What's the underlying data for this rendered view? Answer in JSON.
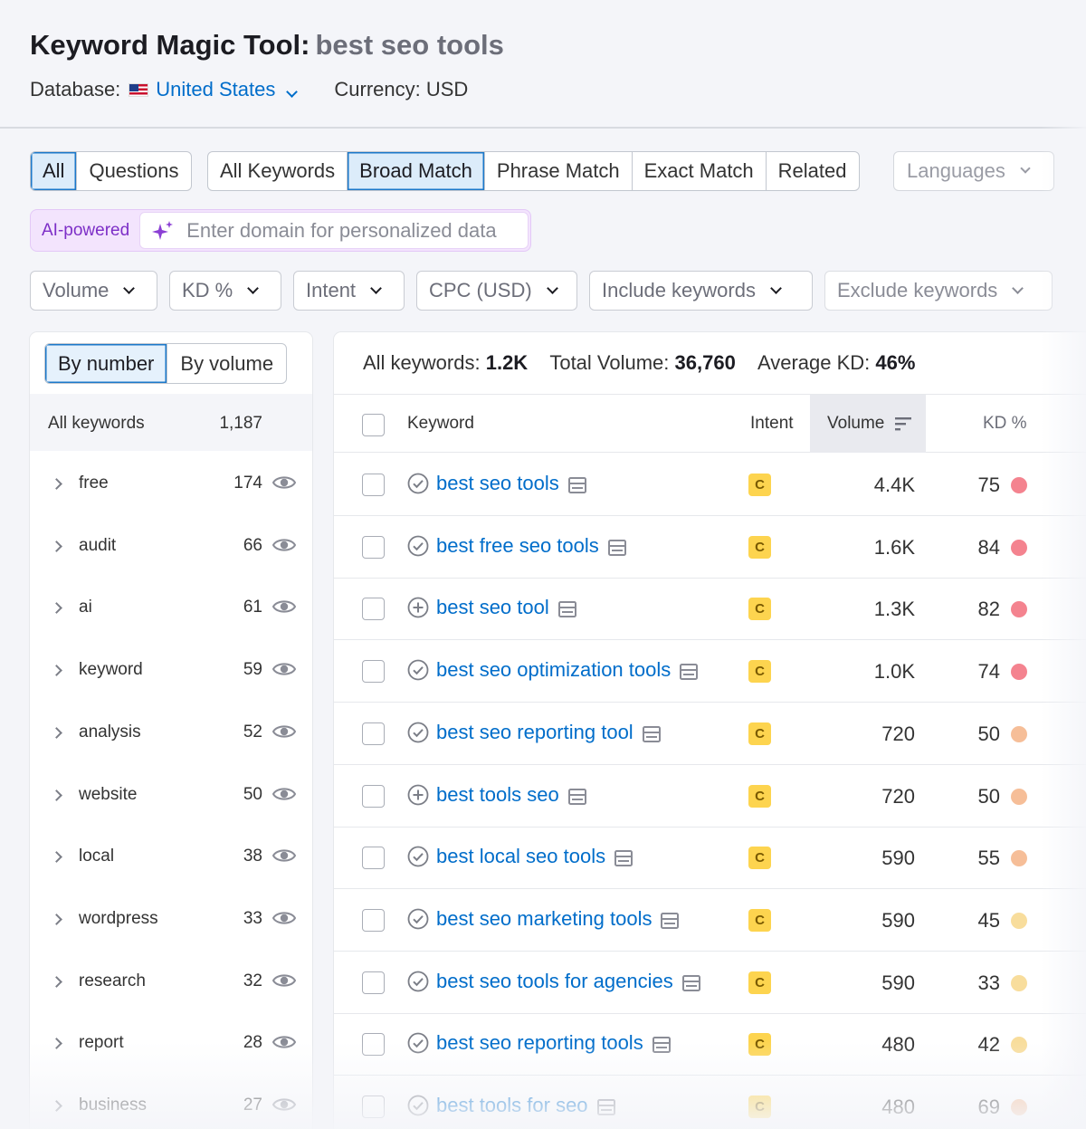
{
  "header": {
    "title": "Keyword Magic Tool:",
    "query": "best seo tools",
    "database_label": "Database:",
    "database_value": "United States",
    "currency": "Currency: USD"
  },
  "tabs": {
    "question_group": [
      "All",
      "Questions"
    ],
    "match_group": [
      "All Keywords",
      "Broad Match",
      "Phrase Match",
      "Exact Match",
      "Related"
    ],
    "active_question": "All",
    "active_match": "Broad Match",
    "languages": "Languages"
  },
  "ai": {
    "label": "AI-powered",
    "placeholder": "Enter domain for personalized data"
  },
  "filters": [
    "Volume",
    "KD %",
    "Intent",
    "CPC (USD)",
    "Include keywords",
    "Exclude keywords"
  ],
  "sidebar": {
    "toggle": [
      "By number",
      "By volume"
    ],
    "active_toggle": "By number",
    "all_label": "All keywords",
    "all_count": "1,187",
    "groups": [
      {
        "name": "free",
        "count": "174"
      },
      {
        "name": "audit",
        "count": "66"
      },
      {
        "name": "ai",
        "count": "61"
      },
      {
        "name": "keyword",
        "count": "59"
      },
      {
        "name": "analysis",
        "count": "52"
      },
      {
        "name": "website",
        "count": "50"
      },
      {
        "name": "local",
        "count": "38"
      },
      {
        "name": "wordpress",
        "count": "33"
      },
      {
        "name": "research",
        "count": "32"
      },
      {
        "name": "report",
        "count": "28"
      },
      {
        "name": "business",
        "count": "27"
      }
    ]
  },
  "summary": {
    "all_label": "All keywords:",
    "all_value": "1.2K",
    "volume_label": "Total Volume:",
    "volume_value": "36,760",
    "kd_label": "Average KD:",
    "kd_value": "46%"
  },
  "table": {
    "columns": [
      "Keyword",
      "Intent",
      "Volume",
      "KD %"
    ],
    "rows": [
      {
        "keyword": "best seo tools",
        "status": "check",
        "intent": "C",
        "volume": "4.4K",
        "kd": "75",
        "kd_color": "#f4838f"
      },
      {
        "keyword": "best free seo tools",
        "status": "check",
        "intent": "C",
        "volume": "1.6K",
        "kd": "84",
        "kd_color": "#f4838f"
      },
      {
        "keyword": "best seo tool",
        "status": "plus",
        "intent": "C",
        "volume": "1.3K",
        "kd": "82",
        "kd_color": "#f4838f"
      },
      {
        "keyword": "best seo optimization tools",
        "status": "check",
        "intent": "C",
        "volume": "1.0K",
        "kd": "74",
        "kd_color": "#f4838f"
      },
      {
        "keyword": "best seo reporting tool",
        "status": "check",
        "intent": "C",
        "volume": "720",
        "kd": "50",
        "kd_color": "#f6be98"
      },
      {
        "keyword": "best tools seo",
        "status": "plus",
        "intent": "C",
        "volume": "720",
        "kd": "50",
        "kd_color": "#f6be98"
      },
      {
        "keyword": "best local seo tools",
        "status": "check",
        "intent": "C",
        "volume": "590",
        "kd": "55",
        "kd_color": "#f6be98"
      },
      {
        "keyword": "best seo marketing tools",
        "status": "check",
        "intent": "C",
        "volume": "590",
        "kd": "45",
        "kd_color": "#f8dd9c"
      },
      {
        "keyword": "best seo tools for agencies",
        "status": "check",
        "intent": "C",
        "volume": "590",
        "kd": "33",
        "kd_color": "#f8dd9c"
      },
      {
        "keyword": "best seo reporting tools",
        "status": "check",
        "intent": "C",
        "volume": "480",
        "kd": "42",
        "kd_color": "#f8dd9c"
      },
      {
        "keyword": "best tools for seo",
        "status": "check",
        "intent": "C",
        "volume": "480",
        "kd": "69",
        "kd_color": "#f6be98"
      }
    ]
  }
}
